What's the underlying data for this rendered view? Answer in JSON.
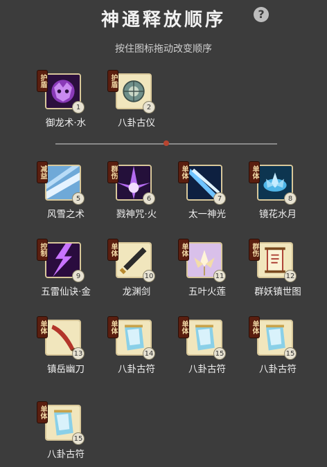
{
  "header": {
    "title": "神通释放顺序",
    "help_symbol": "?",
    "subtitle": "按住图标拖动改变顺序"
  },
  "colors": {
    "background": "#3c3c3c",
    "divider_marker": "#b8442f",
    "tag_bg": "#5a1e0f"
  },
  "top_skills": [
    {
      "name": "御龙术·水",
      "tag": "护盾",
      "order": "1",
      "icon": "purple-dragon-mask-icon"
    },
    {
      "name": "八卦古仪",
      "tag": "护盾",
      "order": "2",
      "icon": "bagua-compass-icon"
    }
  ],
  "skills": [
    {
      "name": "风雪之术",
      "tag": "减益",
      "order": "5",
      "icon": "snowstorm-icon"
    },
    {
      "name": "戮神咒·火",
      "tag": "群伤",
      "order": "6",
      "icon": "purple-blast-icon"
    },
    {
      "name": "太一神光",
      "tag": "单体",
      "order": "7",
      "icon": "blue-light-beam-icon"
    },
    {
      "name": "镜花水月",
      "tag": "单体",
      "order": "8",
      "icon": "water-lotus-icon"
    },
    {
      "name": "五雷仙诀·金",
      "tag": "控制",
      "order": "9",
      "icon": "purple-lightning-icon"
    },
    {
      "name": "龙渊剑",
      "tag": "单体",
      "order": "10",
      "icon": "sword-icon"
    },
    {
      "name": "五叶火莲",
      "tag": "单体",
      "order": "11",
      "icon": "fire-lotus-icon"
    },
    {
      "name": "群妖镇世图",
      "tag": "群伤",
      "order": "12",
      "icon": "scroll-icon"
    },
    {
      "name": "镇岳幽刀",
      "tag": "单体",
      "order": "13",
      "icon": "blade-icon"
    },
    {
      "name": "八卦古符",
      "tag": "单体",
      "order": "14",
      "icon": "talisman-icon"
    },
    {
      "name": "八卦古符",
      "tag": "单体",
      "order": "15",
      "icon": "talisman-icon"
    },
    {
      "name": "八卦古符",
      "tag": "单体",
      "order": "15",
      "icon": "talisman-icon"
    },
    {
      "name": "八卦古符",
      "tag": "单体",
      "order": "15",
      "icon": "talisman-icon"
    }
  ]
}
